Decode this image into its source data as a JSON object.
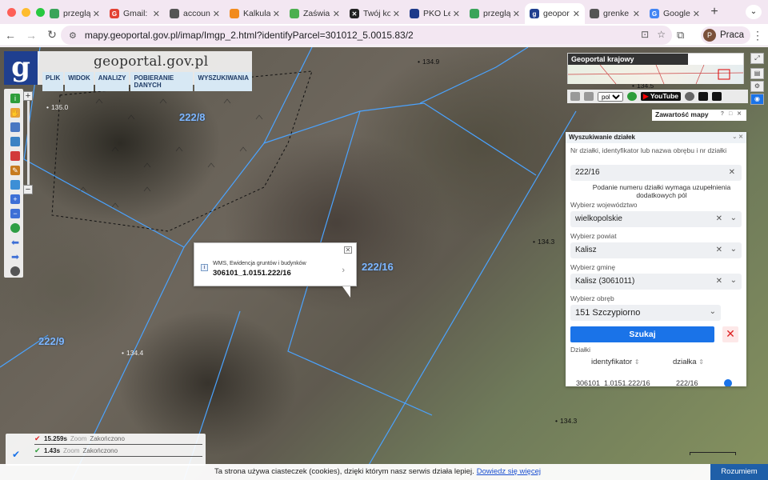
{
  "browser": {
    "tabs": [
      {
        "label": "przeglą",
        "color": "#3aa45a",
        "glyph": ""
      },
      {
        "label": "Gmail: …",
        "color": "#e34133",
        "glyph": "G"
      },
      {
        "label": "account",
        "color": "#555555",
        "glyph": ""
      },
      {
        "label": "Kalkula",
        "color": "#f28b1e",
        "glyph": ""
      },
      {
        "label": "Zaświa",
        "color": "#4caf50",
        "glyph": ""
      },
      {
        "label": "Twój ko",
        "color": "#222222",
        "glyph": "✕"
      },
      {
        "label": "PKO Le",
        "color": "#1e3a8a",
        "glyph": ""
      },
      {
        "label": "przeglą",
        "color": "#3aa45a",
        "glyph": ""
      },
      {
        "label": "geopor",
        "color": "#1f3f8f",
        "glyph": "g",
        "active": true
      },
      {
        "label": "grenke",
        "color": "#555555",
        "glyph": ""
      },
      {
        "label": "Google",
        "color": "#4285f4",
        "glyph": "G"
      }
    ],
    "url": "mapy.geoportal.gov.pl/imap/Imgp_2.html?identifyParcel=301012_5.0015.83/2",
    "profile_initial": "P",
    "profile_name": "Praca"
  },
  "geoportal": {
    "logo_letter": "g",
    "title": "geoportal.gov.pl",
    "menu": [
      "PLIK",
      "WIDOK",
      "ANALIZY",
      "POBIERANIE DANYCH",
      "WYSZUKIWANIA"
    ],
    "overview_title": "Geoportal krajowy",
    "language": "pol",
    "youtube": "YouTube",
    "layers_title": "Zawartość mapy",
    "layers_controls": "? □ ✕"
  },
  "map": {
    "parcels": [
      "222/8",
      "222/16",
      "222/9"
    ],
    "heights": [
      "134.9",
      "135.0",
      "134.5",
      "134.3",
      "134.4",
      "134.3"
    ]
  },
  "popup": {
    "source": "WMS, Ewidencja gruntów i budynków",
    "parcel_id": "306101_1.0151.222/16"
  },
  "search_panel": {
    "title": "Wyszukiwanie działek",
    "query_label": "Nr działki, identyfikator lub nazwa obrębu i nr działki",
    "query_value": "222/16",
    "hint": "Podanie numeru działki wymaga uzupełnienia dodatkowych pól",
    "voivodeship_label": "Wybierz województwo",
    "voivodeship_value": "wielkopolskie",
    "county_label": "Wybierz powiat",
    "county_value": "Kalisz",
    "commune_label": "Wybierz gminę",
    "commune_value": "Kalisz (3061011)",
    "precinct_label": "Wybierz obręb",
    "precinct_value": "151 Szczypiorno",
    "search_button": "Szukaj",
    "results_label": "Działki",
    "col_identifier": "identyfikator",
    "col_parcel": "działka",
    "row_identifier": "306101_1.0151.222/16",
    "row_parcel": "222/16"
  },
  "status": {
    "rows": [
      {
        "time": "15.259s",
        "zoom": "Zoom",
        "state": "Zakończono"
      },
      {
        "time": "1.43s",
        "zoom": "Zoom",
        "state": "Zakończono"
      }
    ]
  },
  "cookie": {
    "text": "Ta strona używa ciasteczek (cookies), dzięki którym nasz serwis działa lepiej.",
    "link": "Dowiedz się więcej",
    "button": "Rozumiem"
  }
}
